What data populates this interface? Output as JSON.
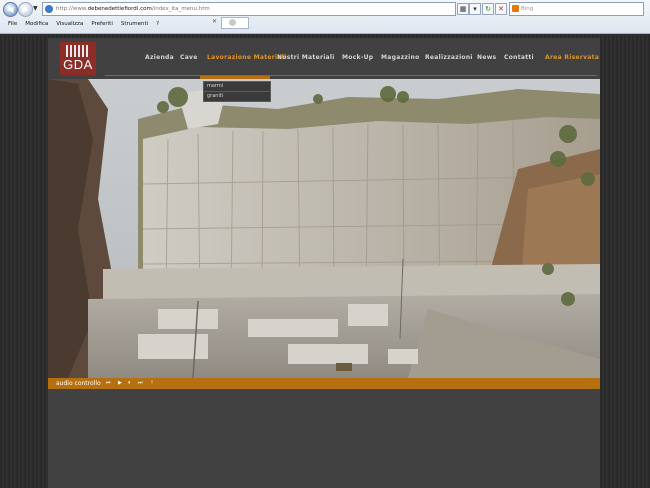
{
  "browser": {
    "url_prefix": "http://www.",
    "url_host": "debenedettiefiordi.com",
    "url_path": "/index_ita_menu.htm",
    "search_placeholder": "Bing",
    "menu": [
      "File",
      "Modifica",
      "Visualizza",
      "Preferiti",
      "Strumenti",
      "?"
    ]
  },
  "site": {
    "logo_text": "GDA",
    "nav": [
      {
        "label": "Azienda"
      },
      {
        "label": "Cave"
      },
      {
        "label": "Lavorazione Materiali"
      },
      {
        "label": "Nostri Materiali"
      },
      {
        "label": "Mock-Up"
      },
      {
        "label": "Magazzino"
      },
      {
        "label": "Realizzazioni"
      },
      {
        "label": "News"
      },
      {
        "label": "Contatti"
      },
      {
        "label": "Area Riservata"
      }
    ],
    "submenu": [
      "marmi",
      "graniti"
    ],
    "audio": {
      "label": "audio controllo",
      "controls": [
        "⏮",
        "▶",
        "⏸",
        "⏭",
        "!"
      ]
    },
    "colors": {
      "accent": "#e39324",
      "bar": "#b7700f",
      "logo_bg": "#8c2d27",
      "panel": "#414141"
    }
  }
}
